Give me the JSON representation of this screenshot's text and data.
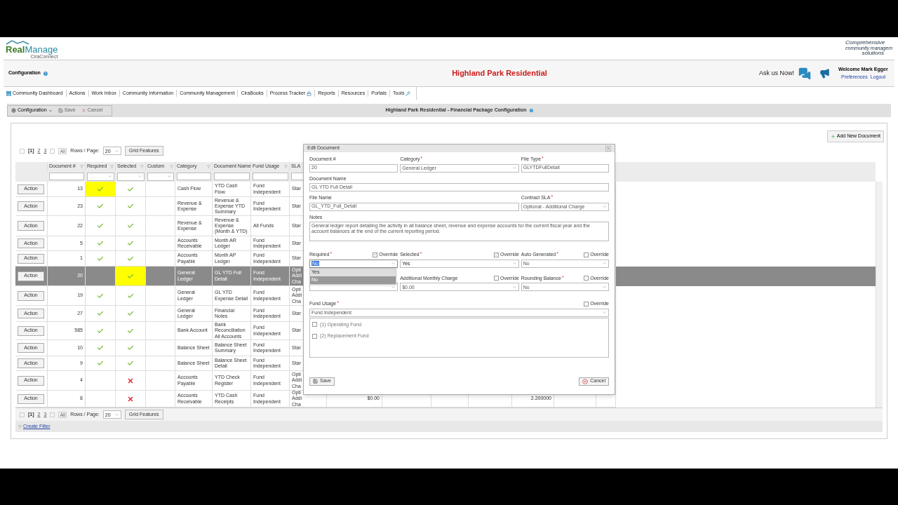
{
  "logo": {
    "main": "Real",
    "accent": "Manage",
    "sub": "CiraConnect"
  },
  "tagline": [
    "Comprehensive",
    "community managem",
    "solutions"
  ],
  "header": {
    "section": "Configuration",
    "title": "Highland Park Residential",
    "ask": "Ask us Now!",
    "welcome": "Welcome Mark Egger",
    "links": [
      "Preferences",
      "Logout"
    ]
  },
  "nav": [
    {
      "label": "Community Dashboard",
      "kind": "home"
    },
    {
      "label": "Actions",
      "kind": "plain"
    },
    {
      "label": "Work Inbox",
      "kind": "plain"
    },
    {
      "label": "Community Information",
      "kind": "plain"
    },
    {
      "label": "Community Management",
      "kind": "plain"
    },
    {
      "label": "CiraBooks",
      "kind": "plain"
    },
    {
      "label": "Process Tracker",
      "kind": "lock"
    },
    {
      "label": "Reports",
      "kind": "plain"
    },
    {
      "label": "Resources",
      "kind": "plain"
    },
    {
      "label": "Portals",
      "kind": "plain"
    },
    {
      "label": "Tools",
      "kind": "tools"
    }
  ],
  "toolbar": {
    "menu": "Configuration",
    "save": "Save",
    "cancel": "Cancel",
    "page_title": "Highland Park Residential - Financial Package Configuration"
  },
  "add_button": "Add New Document",
  "pager_top": {
    "current": "[1]",
    "pages": [
      "2",
      "3"
    ],
    "all": "All",
    "rows_label": "Rows / Page:",
    "rows_value": "20",
    "features": "Grid Features"
  },
  "columns": [
    {
      "label": "Document #",
      "filter_dropdown": false,
      "filter_button": true
    },
    {
      "label": "Required",
      "filter_dropdown": true,
      "filter_button": true
    },
    {
      "label": "Selected",
      "filter_dropdown": true,
      "filter_button": true
    },
    {
      "label": "Custom",
      "filter_dropdown": true,
      "filter_button": true
    },
    {
      "label": "Category",
      "filter_dropdown": false,
      "filter_button": true
    },
    {
      "label": "Document Name",
      "filter_dropdown": false
    },
    {
      "label": "Fund Usage",
      "filter_dropdown": false,
      "filter_button": true
    },
    {
      "label": "SLA",
      "filter_dropdown": false
    }
  ],
  "rows": [
    {
      "action": "Action",
      "number": "13",
      "required": true,
      "included": true,
      "required_highlight": true,
      "included_highlight": false,
      "category": "Cash Flow",
      "name": "YTD Cash Flow",
      "fund": "Fund Independent",
      "sla": "Star",
      "selected": false
    },
    {
      "action": "Action",
      "number": "23",
      "required": true,
      "included": true,
      "required_highlight": false,
      "included_highlight": false,
      "category": "Revenue & Expense",
      "name": "Revenue & Expense YTD Summary",
      "fund": "Fund Independent",
      "sla": "Star",
      "selected": false
    },
    {
      "action": "Action",
      "number": "22",
      "required": true,
      "included": true,
      "required_highlight": false,
      "included_highlight": false,
      "category": "Revenue & Expense",
      "name": "Revenue & Expense (Month & YTD)",
      "fund": "All Funds",
      "sla": "Star",
      "selected": false
    },
    {
      "action": "Action",
      "number": "5",
      "required": true,
      "included": true,
      "required_highlight": false,
      "included_highlight": false,
      "category": "Accounts Receivable",
      "name": "Month AR Ledger",
      "fund": "Fund Independent",
      "sla": "Star",
      "selected": false
    },
    {
      "action": "Action",
      "number": "1",
      "required": true,
      "included": true,
      "required_highlight": false,
      "included_highlight": false,
      "category": "Accounts Payable",
      "name": "Month AP Ledger",
      "fund": "Fund Independent",
      "sla": "Star",
      "selected": false
    },
    {
      "action": "Action",
      "number": "20",
      "required": false,
      "included": true,
      "required_highlight": false,
      "included_highlight": true,
      "category": "General Ledger",
      "name": "GL YTD Full Detail",
      "fund": "Fund Independent",
      "sla": "Opti Addi Cha",
      "selected": true
    },
    {
      "action": "Action",
      "number": "19",
      "required": true,
      "included": true,
      "required_highlight": false,
      "included_highlight": false,
      "category": "General Ledger",
      "name": "GL YTD Expense Detail",
      "fund": "Fund Independent",
      "sla": "Opti Addi Cha",
      "selected": false
    },
    {
      "action": "Action",
      "number": "27",
      "required": true,
      "included": true,
      "required_highlight": false,
      "included_highlight": false,
      "category": "General Ledger",
      "name": "Financial Notes",
      "fund": "Fund Independent",
      "sla": "Star",
      "selected": false
    },
    {
      "action": "Action",
      "number": "585",
      "required": true,
      "included": true,
      "required_highlight": false,
      "included_highlight": false,
      "category": "Bank Account",
      "name": "Bank Reconciliation All Accounts",
      "fund": "Fund Independent",
      "sla": "Star",
      "selected": false
    },
    {
      "action": "Action",
      "number": "10",
      "required": true,
      "included": true,
      "required_highlight": false,
      "included_highlight": false,
      "category": "Balance Sheet",
      "name": "Balance Sheet Summary",
      "fund": "Fund Independent",
      "sla": "Star",
      "selected": false
    },
    {
      "action": "Action",
      "number": "9",
      "required": true,
      "included": true,
      "required_highlight": false,
      "included_highlight": false,
      "category": "Balance Sheet",
      "name": "Balance Sheet Detail",
      "fund": "Fund Independent",
      "sla": "Star",
      "selected": false
    },
    {
      "action": "Action",
      "number": "4",
      "required": false,
      "included": false,
      "required_highlight": false,
      "included_highlight": false,
      "category": "Accounts Payable",
      "name": "YTD Check Register",
      "fund": "Fund Independent",
      "sla": "Opti Addi Cha",
      "selected": false
    },
    {
      "action": "Action",
      "number": "8",
      "required": false,
      "included": false,
      "required_highlight": false,
      "included_highlight": false,
      "category": "Accounts Receivable",
      "name": "YTD Cash Receipts",
      "fund": "Fund Independent",
      "sla": "Opti Addi Cha",
      "column_10": "$0.00",
      "column_14": "2.200000",
      "selected": false
    }
  ],
  "pager_bottom": {
    "current": "[1]",
    "pages": [
      "2",
      "3"
    ],
    "all": "All",
    "rows_label": "Rows / Page:",
    "rows_value": "20",
    "features": "Grid Features"
  },
  "create_filter": "Create Filter",
  "dialog": {
    "title": "Edit Document",
    "document_number": {
      "label": "Document #",
      "value": "20"
    },
    "category": {
      "label": "Category",
      "mark": "*",
      "value": "General Ledger"
    },
    "file_type": {
      "label": "File Type",
      "mark": "*",
      "value": "GLYTDFullDetail"
    },
    "document_name": {
      "label": "Document Name",
      "value": "GL YTD Full Detail"
    },
    "file_name": {
      "label": "File Name",
      "value": "GL_YTD_Full_Detail"
    },
    "contract_sla": {
      "label": "Contract SLA",
      "mark": "*",
      "value": "Optional - Additional Charge"
    },
    "notes": {
      "label": "Notes",
      "value": "General ledger report detailing the activity in all balance sheet, revenue and expense accounts for the current fiscal year and the account balances at the end of the current reporting period."
    },
    "row1": [
      {
        "label": "Required",
        "mark": "*",
        "override": "Override",
        "checked": true,
        "value": "No"
      },
      {
        "label": "Selected",
        "mark": "*",
        "override": "Override",
        "checked": true,
        "value": "Yes"
      },
      {
        "label": "Auto Generated",
        "mark": "*",
        "override": "Override",
        "checked": false,
        "value": "No"
      }
    ],
    "dropdown": [
      {
        "label": "Yes",
        "selected": false
      },
      {
        "label": "No",
        "selected": true
      }
    ],
    "row2": [
      {
        "label": "Additional Monthly Charge",
        "override": "Override",
        "checked": false,
        "value": "$0.00"
      },
      {
        "label": "Rounding Balance",
        "mark": "*",
        "override": "Override",
        "checked": false,
        "value": "No"
      }
    ],
    "fund_usage": {
      "label": "Fund Usage",
      "mark": "*",
      "override": "Override",
      "checked": false,
      "value": "Fund Independent",
      "funds": [
        {
          "label": "(1) Operating Fund",
          "checked": false
        },
        {
          "label": "(2) Replacement Fund",
          "checked": false
        }
      ]
    },
    "save": "Save",
    "cancel": "Cancel",
    "close": "×"
  }
}
